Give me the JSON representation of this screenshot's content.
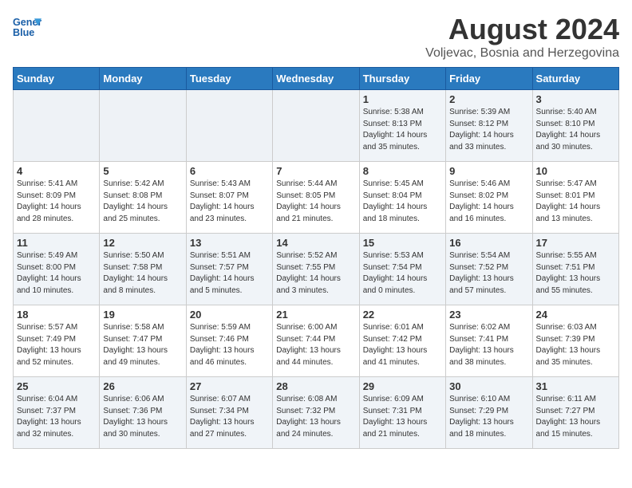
{
  "logo": {
    "line1": "General",
    "line2": "Blue"
  },
  "title": "August 2024",
  "subtitle": "Voljevac, Bosnia and Herzegovina",
  "days_of_week": [
    "Sunday",
    "Monday",
    "Tuesday",
    "Wednesday",
    "Thursday",
    "Friday",
    "Saturday"
  ],
  "weeks": [
    [
      {
        "day": "",
        "info": ""
      },
      {
        "day": "",
        "info": ""
      },
      {
        "day": "",
        "info": ""
      },
      {
        "day": "",
        "info": ""
      },
      {
        "day": "1",
        "info": "Sunrise: 5:38 AM\nSunset: 8:13 PM\nDaylight: 14 hours\nand 35 minutes."
      },
      {
        "day": "2",
        "info": "Sunrise: 5:39 AM\nSunset: 8:12 PM\nDaylight: 14 hours\nand 33 minutes."
      },
      {
        "day": "3",
        "info": "Sunrise: 5:40 AM\nSunset: 8:10 PM\nDaylight: 14 hours\nand 30 minutes."
      }
    ],
    [
      {
        "day": "4",
        "info": "Sunrise: 5:41 AM\nSunset: 8:09 PM\nDaylight: 14 hours\nand 28 minutes."
      },
      {
        "day": "5",
        "info": "Sunrise: 5:42 AM\nSunset: 8:08 PM\nDaylight: 14 hours\nand 25 minutes."
      },
      {
        "day": "6",
        "info": "Sunrise: 5:43 AM\nSunset: 8:07 PM\nDaylight: 14 hours\nand 23 minutes."
      },
      {
        "day": "7",
        "info": "Sunrise: 5:44 AM\nSunset: 8:05 PM\nDaylight: 14 hours\nand 21 minutes."
      },
      {
        "day": "8",
        "info": "Sunrise: 5:45 AM\nSunset: 8:04 PM\nDaylight: 14 hours\nand 18 minutes."
      },
      {
        "day": "9",
        "info": "Sunrise: 5:46 AM\nSunset: 8:02 PM\nDaylight: 14 hours\nand 16 minutes."
      },
      {
        "day": "10",
        "info": "Sunrise: 5:47 AM\nSunset: 8:01 PM\nDaylight: 14 hours\nand 13 minutes."
      }
    ],
    [
      {
        "day": "11",
        "info": "Sunrise: 5:49 AM\nSunset: 8:00 PM\nDaylight: 14 hours\nand 10 minutes."
      },
      {
        "day": "12",
        "info": "Sunrise: 5:50 AM\nSunset: 7:58 PM\nDaylight: 14 hours\nand 8 minutes."
      },
      {
        "day": "13",
        "info": "Sunrise: 5:51 AM\nSunset: 7:57 PM\nDaylight: 14 hours\nand 5 minutes."
      },
      {
        "day": "14",
        "info": "Sunrise: 5:52 AM\nSunset: 7:55 PM\nDaylight: 14 hours\nand 3 minutes."
      },
      {
        "day": "15",
        "info": "Sunrise: 5:53 AM\nSunset: 7:54 PM\nDaylight: 14 hours\nand 0 minutes."
      },
      {
        "day": "16",
        "info": "Sunrise: 5:54 AM\nSunset: 7:52 PM\nDaylight: 13 hours\nand 57 minutes."
      },
      {
        "day": "17",
        "info": "Sunrise: 5:55 AM\nSunset: 7:51 PM\nDaylight: 13 hours\nand 55 minutes."
      }
    ],
    [
      {
        "day": "18",
        "info": "Sunrise: 5:57 AM\nSunset: 7:49 PM\nDaylight: 13 hours\nand 52 minutes."
      },
      {
        "day": "19",
        "info": "Sunrise: 5:58 AM\nSunset: 7:47 PM\nDaylight: 13 hours\nand 49 minutes."
      },
      {
        "day": "20",
        "info": "Sunrise: 5:59 AM\nSunset: 7:46 PM\nDaylight: 13 hours\nand 46 minutes."
      },
      {
        "day": "21",
        "info": "Sunrise: 6:00 AM\nSunset: 7:44 PM\nDaylight: 13 hours\nand 44 minutes."
      },
      {
        "day": "22",
        "info": "Sunrise: 6:01 AM\nSunset: 7:42 PM\nDaylight: 13 hours\nand 41 minutes."
      },
      {
        "day": "23",
        "info": "Sunrise: 6:02 AM\nSunset: 7:41 PM\nDaylight: 13 hours\nand 38 minutes."
      },
      {
        "day": "24",
        "info": "Sunrise: 6:03 AM\nSunset: 7:39 PM\nDaylight: 13 hours\nand 35 minutes."
      }
    ],
    [
      {
        "day": "25",
        "info": "Sunrise: 6:04 AM\nSunset: 7:37 PM\nDaylight: 13 hours\nand 32 minutes."
      },
      {
        "day": "26",
        "info": "Sunrise: 6:06 AM\nSunset: 7:36 PM\nDaylight: 13 hours\nand 30 minutes."
      },
      {
        "day": "27",
        "info": "Sunrise: 6:07 AM\nSunset: 7:34 PM\nDaylight: 13 hours\nand 27 minutes."
      },
      {
        "day": "28",
        "info": "Sunrise: 6:08 AM\nSunset: 7:32 PM\nDaylight: 13 hours\nand 24 minutes."
      },
      {
        "day": "29",
        "info": "Sunrise: 6:09 AM\nSunset: 7:31 PM\nDaylight: 13 hours\nand 21 minutes."
      },
      {
        "day": "30",
        "info": "Sunrise: 6:10 AM\nSunset: 7:29 PM\nDaylight: 13 hours\nand 18 minutes."
      },
      {
        "day": "31",
        "info": "Sunrise: 6:11 AM\nSunset: 7:27 PM\nDaylight: 13 hours\nand 15 minutes."
      }
    ]
  ]
}
